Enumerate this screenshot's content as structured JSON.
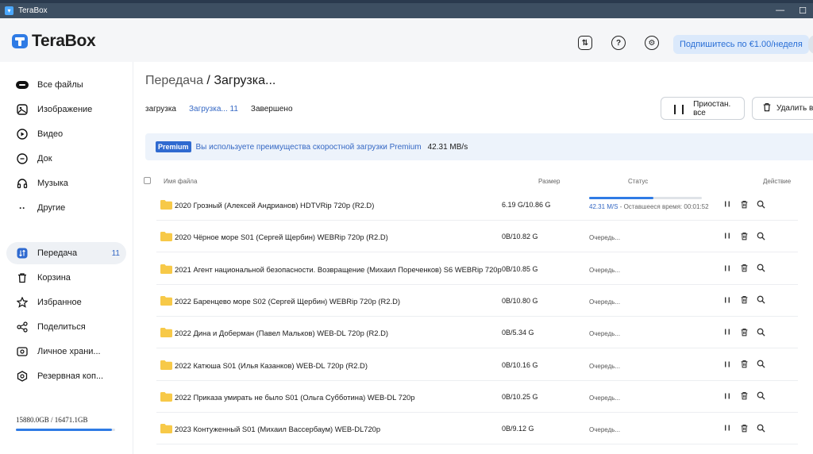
{
  "window": {
    "title": "TeraBox"
  },
  "header": {
    "logo_text": "TeraBox",
    "subscribe_label": "Подпишитесь по €1.00/неделя"
  },
  "sidebar": {
    "items": [
      {
        "label": "Все файлы",
        "icon": "cloud-pill-icon"
      },
      {
        "label": "Изображение",
        "icon": "image-icon"
      },
      {
        "label": "Видео",
        "icon": "play-circle-icon"
      },
      {
        "label": "Док",
        "icon": "document-icon"
      },
      {
        "label": "Музыка",
        "icon": "headphones-icon"
      },
      {
        "label": "Другие",
        "icon": "more-dots-icon"
      },
      {
        "label": "Передача",
        "icon": "transfer-icon",
        "badge": "11",
        "active": true
      },
      {
        "label": "Корзина",
        "icon": "trash-icon"
      },
      {
        "label": "Избранное",
        "icon": "star-icon"
      },
      {
        "label": "Поделиться",
        "icon": "share-icon"
      },
      {
        "label": "Личное храни...",
        "icon": "private-safe-icon"
      },
      {
        "label": "Резервная коп...",
        "icon": "backup-icon"
      }
    ],
    "storage_text": "15880.0GB / 16471.1GB",
    "storage_used_fraction": 0.964
  },
  "main": {
    "title_part1": "Передача",
    "title_sep": " / ",
    "title_part2": "Загрузка...",
    "tabs": [
      {
        "label": "загрузка"
      },
      {
        "label": "Загрузка... 11",
        "active": true
      },
      {
        "label": "Завершено"
      }
    ],
    "pause_all_label": "Приостан. все",
    "delete_all_label": "Удалить вс",
    "banner": {
      "tag": "Premium",
      "text": "Вы используете преимущества скоростной загрузки Premium",
      "speed": "42.31 MB/s"
    },
    "columns": {
      "name": "Имя файла",
      "size": "Размер",
      "status": "Статус",
      "action": "Действие"
    },
    "rows": [
      {
        "name": "2020 Грозный (Алексей Андрианов) HDTVRip 720p (R2.D)",
        "size": "6.19 G/10.86 G",
        "progress": 0.57,
        "speed": "42.31 M/S",
        "remaining": " - Оставшееся время: 00:01:52"
      },
      {
        "name": "2020 Чёрное море S01 (Сергей Щербин) WEBRip 720p (R2.D)",
        "size": "0B/10.82 G",
        "status": "Очередь..."
      },
      {
        "name": "2021 Агент национальной безопасности. Возвращение (Михаил Пореченков) S6 WEBRip 720p",
        "size": "0B/10.85 G",
        "status": "Очередь..."
      },
      {
        "name": "2022 Баренцево море S02 (Сергей Щербин) WEBRip 720p (R2.D)",
        "size": "0B/10.80 G",
        "status": "Очередь..."
      },
      {
        "name": "2022 Дина и Доберман (Павел Мальков) WEB-DL 720p (R2.D)",
        "size": "0B/5.34 G",
        "status": "Очередь..."
      },
      {
        "name": "2022 Катюша S01 (Илья Казанков) WEB-DL 720p (R2.D)",
        "size": "0B/10.16 G",
        "status": "Очередь..."
      },
      {
        "name": "2022 Приказа умирать не было S01 (Ольга Субботина) WEB-DL 720p",
        "size": "0B/10.25 G",
        "status": "Очередь..."
      },
      {
        "name": "2023 Контуженный S01 (Михаил Вассербаум) WEB-DL720p",
        "size": "0B/9.12 G",
        "status": "Очередь..."
      }
    ]
  },
  "colors": {
    "accent": "#3568c4",
    "progress": "#2f7be5",
    "folder": "#f7c948",
    "banner_bg": "#edf3fb",
    "title_bar": "#3d4f62"
  }
}
